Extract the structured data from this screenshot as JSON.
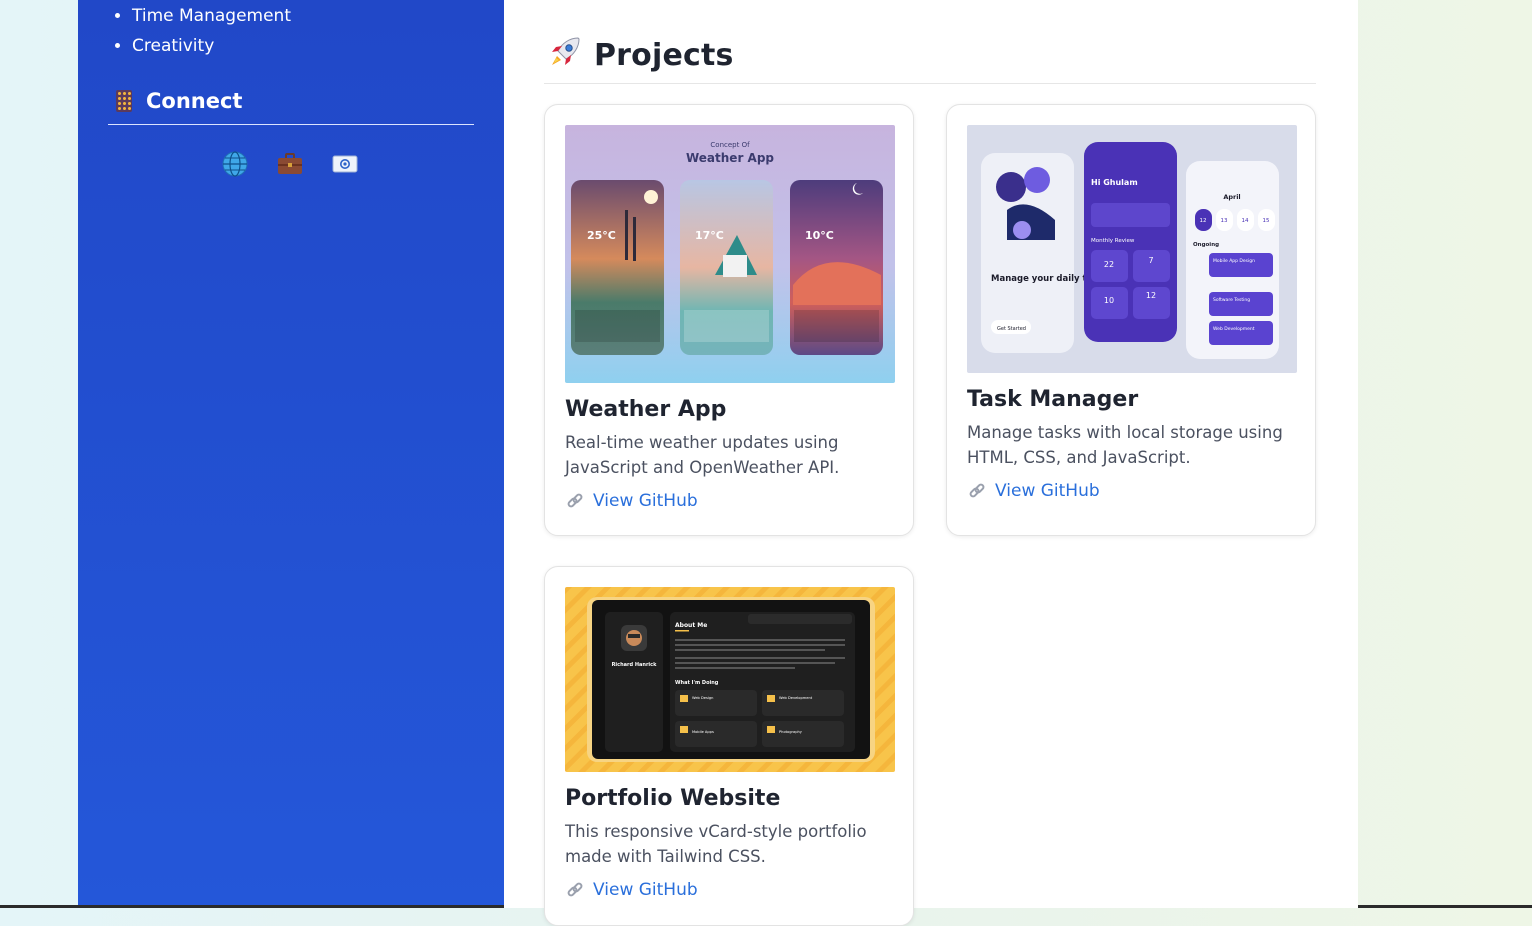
{
  "sidebar": {
    "skills": [
      "Time Management",
      "Creativity"
    ],
    "connect_title": "Connect",
    "social_icons": [
      "globe-icon",
      "briefcase-icon",
      "email-icon"
    ]
  },
  "main": {
    "section_title": "Projects",
    "section_icon": "rocket-icon",
    "projects": [
      {
        "title": "Weather App",
        "description": "Real-time weather updates using JavaScript and OpenWeather API.",
        "link_label": "View GitHub",
        "image": {
          "heading_small": "Concept Of",
          "heading": "Weather App",
          "temps": [
            "25°C",
            "17°C",
            "10°C"
          ]
        }
      },
      {
        "title": "Task Manager",
        "description": "Manage tasks with local storage using HTML, CSS, and JavaScript.",
        "link_label": "View GitHub",
        "image": {
          "left_text": "Manage your daily tasks",
          "left_sub": "Team and Project management with solution providing App",
          "get_started": "Get Started",
          "greeting": "Hi Ghulam",
          "review": "Monthly Review",
          "stats": [
            "22",
            "7",
            "10",
            "12"
          ],
          "month": "April",
          "days": [
            "12",
            "13",
            "14",
            "15"
          ],
          "ongoing": "Ongoing",
          "tasks": [
            "Mobile App Design",
            "Software Testing",
            "Web Development"
          ]
        }
      },
      {
        "title": "Portfolio Website",
        "description": "This responsive vCard-style portfolio made with Tailwind CSS.",
        "link_label": "View GitHub",
        "image": {
          "name": "Richard Hanrick",
          "about": "About Me",
          "doing": "What I'm Doing",
          "nav": [
            "About",
            "Resume",
            "Portfolio",
            "Blog",
            "Contact"
          ],
          "services": [
            "Web Design",
            "Web Development",
            "Mobile Apps",
            "Photography"
          ]
        }
      }
    ]
  },
  "colors": {
    "sidebar": "#2252d6",
    "link": "#2a6fdb",
    "title": "#1f2430"
  }
}
